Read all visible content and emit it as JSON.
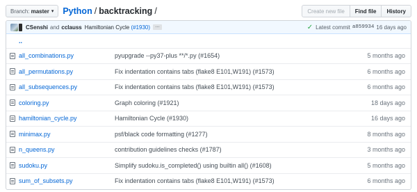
{
  "branch": {
    "label": "Branch:",
    "value": "master"
  },
  "breadcrumb": {
    "repo": "Python",
    "separator": "/",
    "dir": "backtracking",
    "trailing": "/"
  },
  "actions": {
    "create_new_file": "Create new file",
    "find_file": "Find file",
    "history": "History"
  },
  "commit": {
    "author1": "CSenshi",
    "and": "and",
    "author2": "cclauss",
    "message": "Hamiltonian Cycle",
    "pr": "(#1930)",
    "ellipsis": "…",
    "latest_label": "Latest commit",
    "sha": "a859934",
    "age": "16 days ago"
  },
  "up_dir": "..",
  "files": [
    {
      "name": "all_combinations.py",
      "message": "pyupgrade --py37-plus **/*.py (#1654)",
      "age": "5 months ago"
    },
    {
      "name": "all_permutations.py",
      "message": "Fix indentation contains tabs (flake8 E101,W191) (#1573)",
      "age": "6 months ago"
    },
    {
      "name": "all_subsequences.py",
      "message": "Fix indentation contains tabs (flake8 E101,W191) (#1573)",
      "age": "6 months ago"
    },
    {
      "name": "coloring.py",
      "message": "Graph coloring (#1921)",
      "age": "18 days ago"
    },
    {
      "name": "hamiltonian_cycle.py",
      "message": "Hamiltonian Cycle (#1930)",
      "age": "16 days ago"
    },
    {
      "name": "minimax.py",
      "message": "psf/black code formatting (#1277)",
      "age": "8 months ago"
    },
    {
      "name": "n_queens.py",
      "message": "contribution guidelines checks (#1787)",
      "age": "3 months ago"
    },
    {
      "name": "sudoku.py",
      "message": "Simplify sudoku.is_completed() using builtin all() (#1608)",
      "age": "5 months ago"
    },
    {
      "name": "sum_of_subsets.py",
      "message": "Fix indentation contains tabs (flake8 E101,W191) (#1573)",
      "age": "6 months ago"
    }
  ],
  "icons": {
    "file": "file-icon",
    "check": "check-icon",
    "caret": "caret-down-icon"
  },
  "colors": {
    "link": "#0366d6",
    "success": "#28a745",
    "commit_bg": "#f1f8ff"
  }
}
